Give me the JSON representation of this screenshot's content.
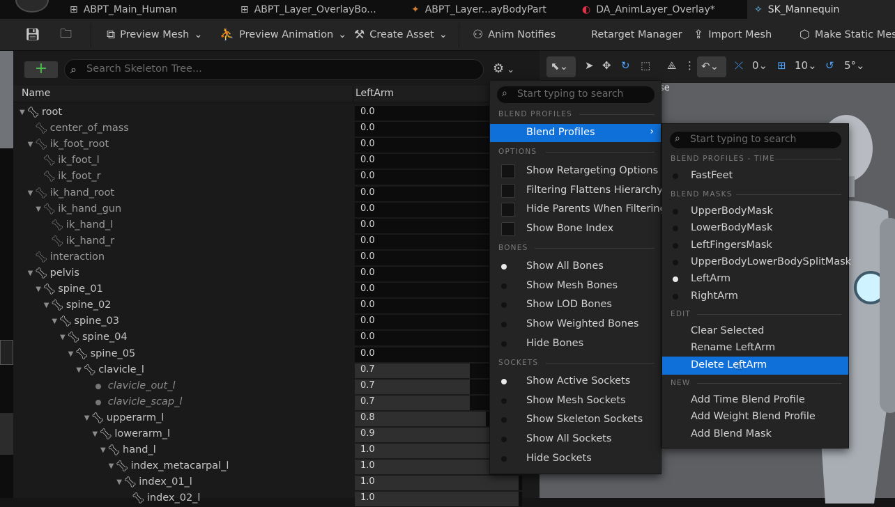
{
  "tabs": [
    {
      "label": "ABPT_Main_Human",
      "icon": "blueprint-icon"
    },
    {
      "label": "ABPT_Layer_OverlayBo...",
      "icon": "blueprint-icon"
    },
    {
      "label": "ABPT_Layer...ayBodyPart",
      "icon": "anim-layer-icon"
    },
    {
      "label": "DA_AnimLayer_Overlay*",
      "icon": "data-asset-icon"
    },
    {
      "label": "SK_Mannequin",
      "icon": "skeleton-icon"
    }
  ],
  "toolbar": {
    "preview_mesh": "Preview Mesh",
    "preview_animation": "Preview Animation",
    "create_asset": "Create Asset",
    "anim_notifies": "Anim Notifies",
    "retarget_manager": "Retarget Manager",
    "import_mesh": "Import Mesh",
    "make_static_mesh": "Make Static Mes"
  },
  "tree": {
    "search_placeholder": "Search Skeleton Tree...",
    "col_name": "Name",
    "col_value": "LeftArm",
    "rows": [
      {
        "name": "root",
        "depth": 0,
        "value": "0.0",
        "fill": 0,
        "arrow": true,
        "style": "bone"
      },
      {
        "name": "center_of_mass",
        "depth": 1,
        "value": "0.0",
        "fill": 0,
        "arrow": false,
        "style": "dim"
      },
      {
        "name": "ik_foot_root",
        "depth": 1,
        "value": "0.0",
        "fill": 0,
        "arrow": true,
        "style": "dim"
      },
      {
        "name": "ik_foot_l",
        "depth": 2,
        "value": "0.0",
        "fill": 0,
        "arrow": false,
        "style": "dim"
      },
      {
        "name": "ik_foot_r",
        "depth": 2,
        "value": "0.0",
        "fill": 0,
        "arrow": false,
        "style": "dim"
      },
      {
        "name": "ik_hand_root",
        "depth": 1,
        "value": "0.0",
        "fill": 0,
        "arrow": true,
        "style": "dim"
      },
      {
        "name": "ik_hand_gun",
        "depth": 2,
        "value": "0.0",
        "fill": 0,
        "arrow": true,
        "style": "dim"
      },
      {
        "name": "ik_hand_l",
        "depth": 3,
        "value": "0.0",
        "fill": 0,
        "arrow": false,
        "style": "dim"
      },
      {
        "name": "ik_hand_r",
        "depth": 3,
        "value": "0.0",
        "fill": 0,
        "arrow": false,
        "style": "dim"
      },
      {
        "name": "interaction",
        "depth": 1,
        "value": "0.0",
        "fill": 0,
        "arrow": false,
        "style": "dim"
      },
      {
        "name": "pelvis",
        "depth": 1,
        "value": "0.0",
        "fill": 0,
        "arrow": true,
        "style": "bone"
      },
      {
        "name": "spine_01",
        "depth": 2,
        "value": "0.0",
        "fill": 0,
        "arrow": true,
        "style": "bone"
      },
      {
        "name": "spine_02",
        "depth": 3,
        "value": "0.0",
        "fill": 0,
        "arrow": true,
        "style": "bone"
      },
      {
        "name": "spine_03",
        "depth": 4,
        "value": "0.0",
        "fill": 0,
        "arrow": true,
        "style": "bone"
      },
      {
        "name": "spine_04",
        "depth": 5,
        "value": "0.0",
        "fill": 0,
        "arrow": true,
        "style": "bone"
      },
      {
        "name": "spine_05",
        "depth": 6,
        "value": "0.0",
        "fill": 0,
        "arrow": true,
        "style": "bone"
      },
      {
        "name": "clavicle_l",
        "depth": 7,
        "value": "0.7",
        "fill": 0.7,
        "arrow": true,
        "style": "bone"
      },
      {
        "name": "clavicle_out_l",
        "depth": 8,
        "value": "0.7",
        "fill": 0.7,
        "arrow": false,
        "style": "virtual"
      },
      {
        "name": "clavicle_scap_l",
        "depth": 8,
        "value": "0.7",
        "fill": 0.7,
        "arrow": false,
        "style": "virtual"
      },
      {
        "name": "upperarm_l",
        "depth": 8,
        "value": "0.8",
        "fill": 0.8,
        "arrow": true,
        "style": "bone"
      },
      {
        "name": "lowerarm_l",
        "depth": 9,
        "value": "0.9",
        "fill": 0.9,
        "arrow": true,
        "style": "bone"
      },
      {
        "name": "hand_l",
        "depth": 10,
        "value": "1.0",
        "fill": 1.0,
        "arrow": true,
        "style": "bone"
      },
      {
        "name": "index_metacarpal_l",
        "depth": 11,
        "value": "1.0",
        "fill": 1.0,
        "arrow": true,
        "style": "bone"
      },
      {
        "name": "index_01_l",
        "depth": 12,
        "value": "1.0",
        "fill": 1.0,
        "arrow": true,
        "style": "bone"
      },
      {
        "name": "index_02_l",
        "depth": 13,
        "value": "1.0",
        "fill": 1.0,
        "arrow": false,
        "style": "bone"
      }
    ]
  },
  "viewport": {
    "angle_snap": "0",
    "grid_snap": "10",
    "rot_snap": "5°",
    "partial_label": "se"
  },
  "options_menu": {
    "search_placeholder": "Start typing to search",
    "sec_blend_profiles": "BLEND PROFILES",
    "blend_profiles": "Blend Profiles",
    "sec_options": "OPTIONS",
    "options": [
      "Show Retargeting Options",
      "Filtering Flattens Hierarchy",
      "Hide Parents When Filtering",
      "Show Bone Index"
    ],
    "sec_bones": "BONES",
    "bones": [
      {
        "label": "Show All Bones",
        "on": true
      },
      {
        "label": "Show Mesh Bones",
        "on": false
      },
      {
        "label": "Show LOD Bones",
        "on": false
      },
      {
        "label": "Show Weighted Bones",
        "on": false
      },
      {
        "label": "Hide Bones",
        "on": false
      }
    ],
    "sec_sockets": "SOCKETS",
    "sockets": [
      {
        "label": "Show Active Sockets",
        "on": true
      },
      {
        "label": "Show Mesh Sockets",
        "on": false
      },
      {
        "label": "Show Skeleton Sockets",
        "on": false
      },
      {
        "label": "Show All Sockets",
        "on": false
      },
      {
        "label": "Hide Sockets",
        "on": false
      }
    ]
  },
  "profiles_menu": {
    "search_placeholder": "Start typing to search",
    "sec_time": "BLEND PROFILES - TIME",
    "time": [
      {
        "label": "FastFeet",
        "on": false
      }
    ],
    "sec_masks": "BLEND MASKS",
    "masks": [
      {
        "label": "UpperBodyMask",
        "on": false
      },
      {
        "label": "LowerBodyMask",
        "on": false
      },
      {
        "label": "LeftFingersMask",
        "on": false
      },
      {
        "label": "UpperBodyLowerBodySplitMask",
        "on": false
      },
      {
        "label": "LeftArm",
        "on": true
      },
      {
        "label": "RightArm",
        "on": false
      }
    ],
    "sec_edit": "EDIT",
    "edit": [
      "Clear Selected",
      "Rename LeftArm",
      "Delete LeftArm"
    ],
    "sec_new": "NEW",
    "new": [
      "Add Time Blend Profile",
      "Add Weight Blend Profile",
      "Add Blend Mask"
    ]
  },
  "colors": {
    "accent": "#0e70d8",
    "add": "#4bc04b",
    "snap_blue": "#4aa3ff"
  }
}
